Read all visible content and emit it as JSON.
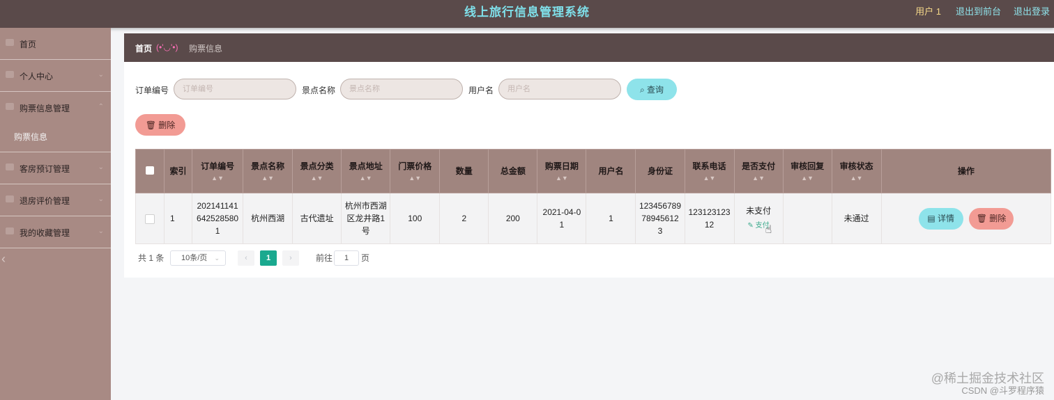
{
  "header": {
    "title": "线上旅行信息管理系统",
    "user": "用户 1",
    "to_front": "退出到前台",
    "logout": "退出登录"
  },
  "sidebar": {
    "items": [
      {
        "label": "首页"
      },
      {
        "label": "个人中心"
      },
      {
        "label": "购票信息管理"
      },
      {
        "label": "客房预订管理"
      },
      {
        "label": "退房评价管理"
      },
      {
        "label": "我的收藏管理"
      }
    ],
    "sub_item": "购票信息",
    "collapse_icon": "chevron-left-icon"
  },
  "breadcrumb": {
    "home": "首页",
    "separator": "(•'◡'•)",
    "current": "购票信息"
  },
  "search": {
    "order_label": "订单编号",
    "order_placeholder": "订单编号",
    "spot_label": "景点名称",
    "spot_placeholder": "景点名称",
    "user_label": "用户名",
    "user_placeholder": "用户名",
    "button": "查询"
  },
  "actions": {
    "delete_label": "删除"
  },
  "table": {
    "columns": [
      "索引",
      "订单编号",
      "景点名称",
      "景点分类",
      "景点地址",
      "门票价格",
      "数量",
      "总金额",
      "购票日期",
      "用户名",
      "身份证",
      "联系电话",
      "是否支付",
      "审核回复",
      "审核状态",
      "操作"
    ],
    "rows": [
      {
        "index": "1",
        "order_no": "2021411416425285801",
        "spot_name": "杭州西湖",
        "spot_type": "古代遗址",
        "spot_address": "杭州市西湖区龙井路1号",
        "price": "100",
        "quantity": "2",
        "total": "200",
        "date": "2021-04-01",
        "username": "1",
        "id_card": "12345678978945612 3",
        "phone": "12312312312",
        "paid": "未支付",
        "pay_link": "支付",
        "reply": "",
        "status": "未通过",
        "detail_button": "详情",
        "delete_button": "删除"
      }
    ]
  },
  "pagination": {
    "total": "共 1 条",
    "page_size": "10条/页",
    "current_page": "1",
    "goto_prefix": "前往",
    "goto_value": "1",
    "goto_suffix": "页"
  },
  "watermark": {
    "line1": "@稀土掘金技术社区",
    "line2": "CSDN @斗罗程序猿"
  },
  "colors": {
    "topbar": "#5a4a4a",
    "sidebar": "#a88a84",
    "title": "#7fe0ea",
    "accent_cyan": "#8ee3ea",
    "accent_red": "#f29b94",
    "page_active": "#1aa98f"
  }
}
